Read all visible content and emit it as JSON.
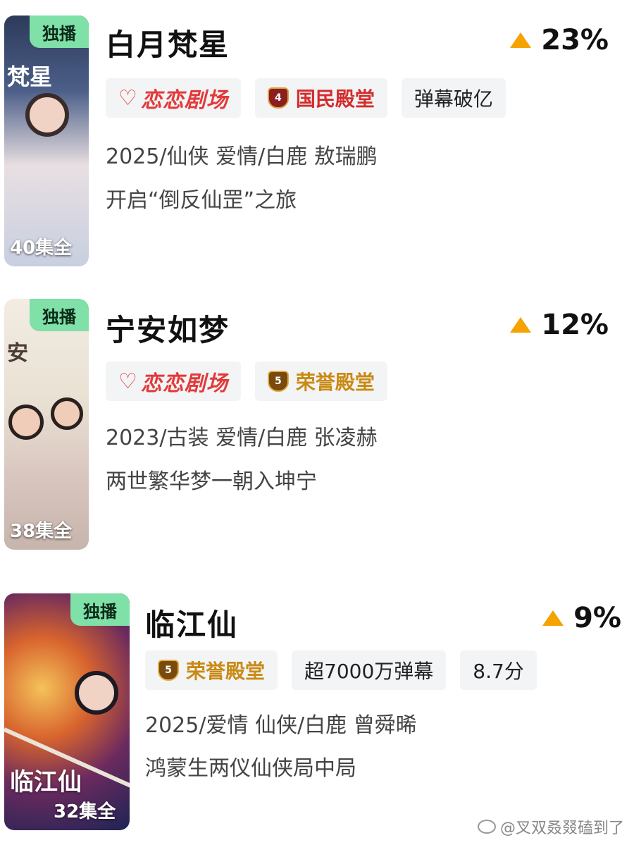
{
  "shows": [
    {
      "title": "白月梵星",
      "badge": "独播",
      "episodes": "40集全",
      "trend": "23%",
      "tags": [
        "恋恋剧场",
        "国民殿堂",
        "弹幕破亿"
      ],
      "hall_level": "4",
      "meta": "2025/仙侠 爱情/白鹿 敖瑞鹏",
      "slogan": "开启“倒反仙罡”之旅",
      "poster_text": "梵星"
    },
    {
      "title": "宁安如梦",
      "badge": "独播",
      "episodes": "38集全",
      "trend": "12%",
      "tags": [
        "恋恋剧场",
        "荣誉殿堂"
      ],
      "hall_level": "5",
      "meta": "2023/古装 爱情/白鹿 张凌赫",
      "slogan": "两世繁华梦一朝入坤宁",
      "poster_text": "安"
    },
    {
      "title": "临江仙",
      "badge": "独播",
      "episodes": "32集全",
      "trend": "9%",
      "tags": [
        "荣誉殿堂",
        "超7000万弹幕",
        "8.7分"
      ],
      "hall_level": "5",
      "meta": "2025/爱情 仙侠/白鹿 曾舜晞",
      "slogan": "鸿蒙生两仪仙侠局中局",
      "poster_text": "临江仙"
    }
  ],
  "watermark": "@叉双叒叕磕到了",
  "icons": {
    "trend": "triangle-up-icon",
    "brand": "heart-logo-icon",
    "hall": "shield-badge-icon"
  },
  "colors": {
    "badge": "#7fe0a8",
    "trend_up": "#f5a300",
    "brand_red": "#e23a3a",
    "hall_gold": "#c98a14"
  }
}
